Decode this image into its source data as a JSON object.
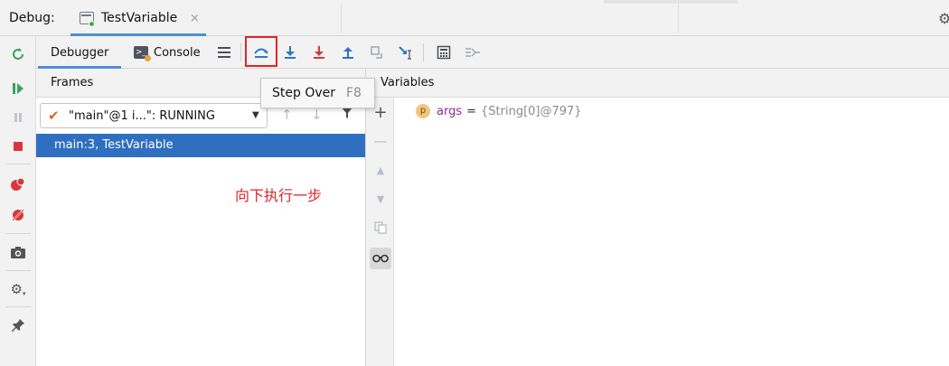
{
  "titlebar": {
    "debug_label": "Debug:",
    "tab_title": "TestVariable",
    "close_glyph": "×"
  },
  "subbar": {
    "tab_debugger": "Debugger",
    "tab_console": "Console",
    "actions": [
      {
        "icon": "show-execution-point-icon"
      },
      {
        "icon": "step-over-icon"
      },
      {
        "icon": "step-into-icon"
      },
      {
        "icon": "force-step-into-icon"
      },
      {
        "icon": "step-out-icon"
      },
      {
        "icon": "drop-frame-icon"
      },
      {
        "icon": "run-to-cursor-icon"
      },
      {
        "icon": "evaluate-expression-icon"
      },
      {
        "icon": "trace-current-stream-icon"
      }
    ]
  },
  "frames": {
    "header": "Frames",
    "thread_text": "\"main\"@1 i...\": RUNNING",
    "selected_frame": "main:3, TestVariable"
  },
  "variables": {
    "header": "Variables",
    "items": [
      {
        "badge": "p",
        "name": "args",
        "eq": "=",
        "value": "{String[0]@797}"
      }
    ]
  },
  "tooltip": {
    "label": "Step Over",
    "shortcut": "F8"
  },
  "annotation": "向下执行一步",
  "colors": {
    "accent": "#4a8fd6",
    "selection": "#2f6fbf",
    "highlight": "#e0242a"
  }
}
